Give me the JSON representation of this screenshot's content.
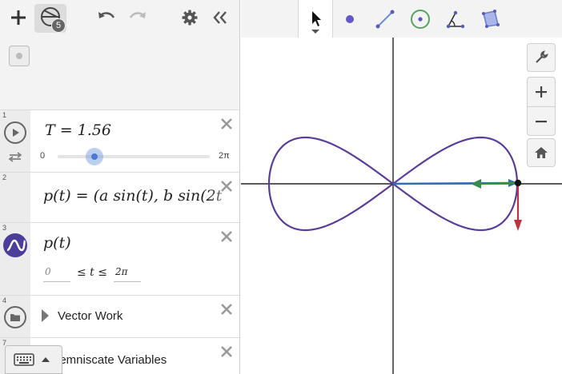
{
  "header": {
    "cas_badge": "5",
    "tools": [
      "pointer-tool",
      "point-tool",
      "segment-tool",
      "circle-tool",
      "angle-tool",
      "polygon-tool"
    ]
  },
  "expressions": [
    {
      "num": "1",
      "kind": "slider",
      "latex_text": "T = 1.56",
      "slider": {
        "min_label": "0",
        "max_label": "2π",
        "value": 1.56,
        "min": 0,
        "max": 6.283
      }
    },
    {
      "num": "2",
      "kind": "expression",
      "latex_text": "p(t) = (a sin(t), b sin(2t"
    },
    {
      "num": "3",
      "kind": "parametric",
      "latex_text": "p(t)",
      "bounds": {
        "lower": "0",
        "op_text": "≤ t ≤",
        "upper": "2π"
      }
    },
    {
      "num": "4",
      "kind": "folder",
      "title": "Vector Work"
    },
    {
      "num": "7",
      "kind": "folder",
      "title": "Lemniscate Variables"
    }
  ],
  "colors": {
    "curve": "#5a3d96",
    "vector_blue": "#2f6fb7",
    "vector_red": "#c0313b",
    "vector_green": "#388c46",
    "slider_thumb": "#4e77cf"
  }
}
